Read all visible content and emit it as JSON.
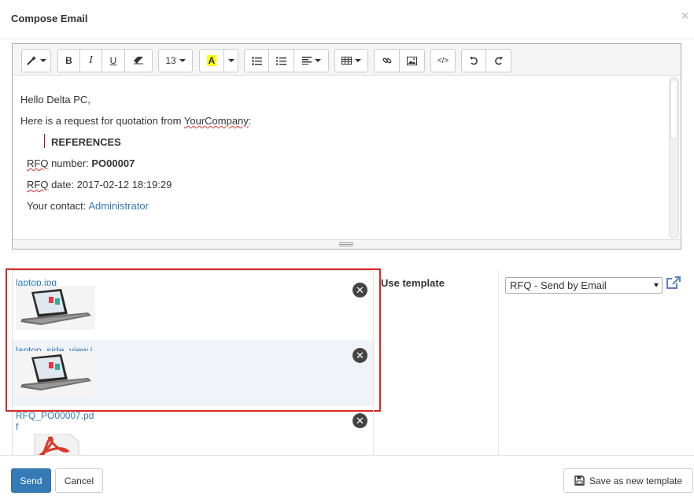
{
  "modal": {
    "title": "Compose Email",
    "close": "×"
  },
  "toolbar": {
    "font_size": "13",
    "highlight_letter": "A",
    "code_label": "</>"
  },
  "body": {
    "greeting": "Hello Delta PC,",
    "intro_prefix": "Here is a request for quotation from ",
    "company": "YourCompany",
    "intro_suffix": ":",
    "references": "REFERENCES",
    "rfq_number_label_a": "RFQ",
    "rfq_number_label_b": " number: ",
    "rfq_number": "PO00007",
    "rfq_date_label_a": "RFQ",
    "rfq_date_label_b": " date: ",
    "rfq_date": "2017-02-12 18:19:29",
    "contact_label": "Your contact: ",
    "contact": "Administrator"
  },
  "attachments": [
    {
      "name": "laptop.jpg",
      "remove": "✕"
    },
    {
      "name": "laptop_side_view.jpg",
      "remove": "✕"
    },
    {
      "name": "RFQ_PO00007.pdf",
      "remove": "✕"
    }
  ],
  "template": {
    "label": "Use template",
    "selected": "RFQ - Send by Email"
  },
  "footer": {
    "send": "Send",
    "cancel": "Cancel",
    "save_template": "Save as new template"
  },
  "colors": {
    "primary": "#337ab7",
    "highlight_border": "#d62828",
    "link": "#337ab7"
  }
}
